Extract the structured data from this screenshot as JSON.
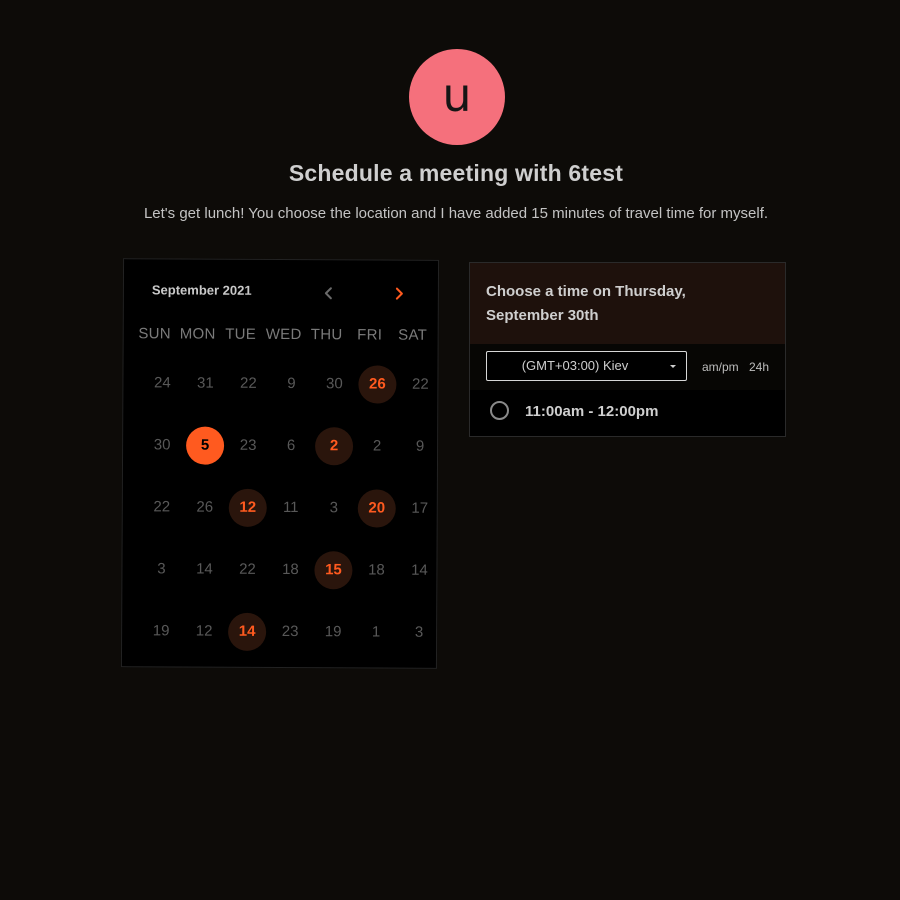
{
  "host": {
    "avatar_initial": "u",
    "avatar_color": "#f5707c"
  },
  "header": {
    "title": "Schedule a meeting with 6test",
    "subtitle": "Let's get lunch! You choose the location and I have added 15 minutes of travel time for myself."
  },
  "calendar": {
    "month_label": "September 2021",
    "prev_icon": "chevron-left-icon",
    "next_icon": "chevron-right-icon",
    "accent_color": "#ff5a1f",
    "weekdays": [
      "SUN",
      "MON",
      "TUE",
      "WED",
      "THU",
      "FRI",
      "SAT"
    ],
    "weeks": [
      [
        {
          "d": "24"
        },
        {
          "d": "31"
        },
        {
          "d": "22"
        },
        {
          "d": "9"
        },
        {
          "d": "30"
        },
        {
          "d": "26",
          "s": "avail"
        },
        {
          "d": "22"
        }
      ],
      [
        {
          "d": "30"
        },
        {
          "d": "5",
          "s": "selected"
        },
        {
          "d": "23"
        },
        {
          "d": "6"
        },
        {
          "d": "2",
          "s": "avail"
        },
        {
          "d": "2"
        },
        {
          "d": "9"
        }
      ],
      [
        {
          "d": "22"
        },
        {
          "d": "26"
        },
        {
          "d": "12",
          "s": "avail"
        },
        {
          "d": "11"
        },
        {
          "d": "3"
        },
        {
          "d": "20",
          "s": "avail"
        },
        {
          "d": "17"
        }
      ],
      [
        {
          "d": "3"
        },
        {
          "d": "14"
        },
        {
          "d": "22"
        },
        {
          "d": "18"
        },
        {
          "d": "15",
          "s": "avail"
        },
        {
          "d": "18"
        },
        {
          "d": "14"
        }
      ],
      [
        {
          "d": "19"
        },
        {
          "d": "12"
        },
        {
          "d": "14",
          "s": "avail"
        },
        {
          "d": "23"
        },
        {
          "d": "19"
        },
        {
          "d": "1"
        },
        {
          "d": "3"
        }
      ]
    ]
  },
  "time_panel": {
    "title": "Choose a time on Thursday, September 30th",
    "timezone_value": "(GMT+03:00) Kiev",
    "format_ampm": "am/pm",
    "format_24h": "24h",
    "slots": [
      {
        "label": "11:00am - 12:00pm",
        "selected": false
      }
    ],
    "header_bg": "#1e110c"
  }
}
